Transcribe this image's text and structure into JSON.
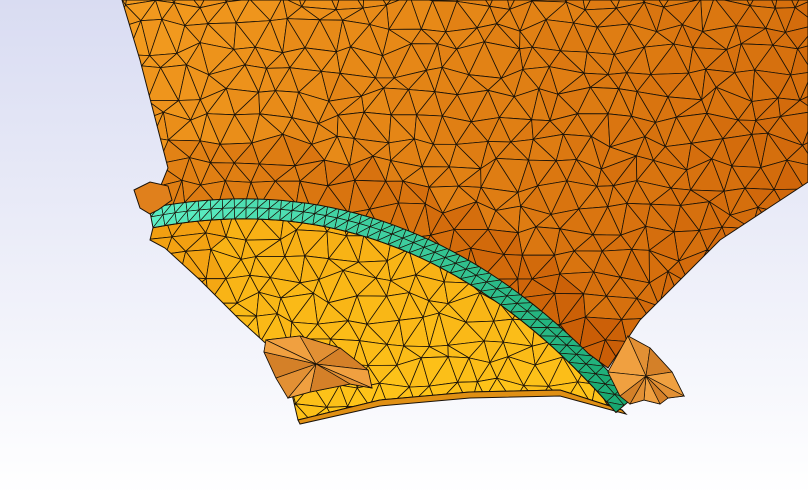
{
  "viewport": {
    "background_top": "#d9dcf2",
    "background_bottom": "#ffffff"
  },
  "mesh": {
    "edge_color": "#1a1208",
    "regions": [
      {
        "id": "upper-blade-surface",
        "icon": "mesh-surface-icon",
        "fill_light": "#f29a1e",
        "fill_dark": "#c95c06"
      },
      {
        "id": "lower-platform-surface",
        "icon": "mesh-surface-icon",
        "fill_light": "#ffc81a",
        "fill_dark": "#f09a10"
      },
      {
        "id": "interface-band",
        "icon": "mesh-band-icon",
        "fill_light": "#5ff0c6",
        "fill_dark": "#14a46c"
      },
      {
        "id": "cut-pocket",
        "icon": "mesh-pocket-icon",
        "fill_light": "#f0a040",
        "fill_dark": "#b86010"
      }
    ]
  }
}
